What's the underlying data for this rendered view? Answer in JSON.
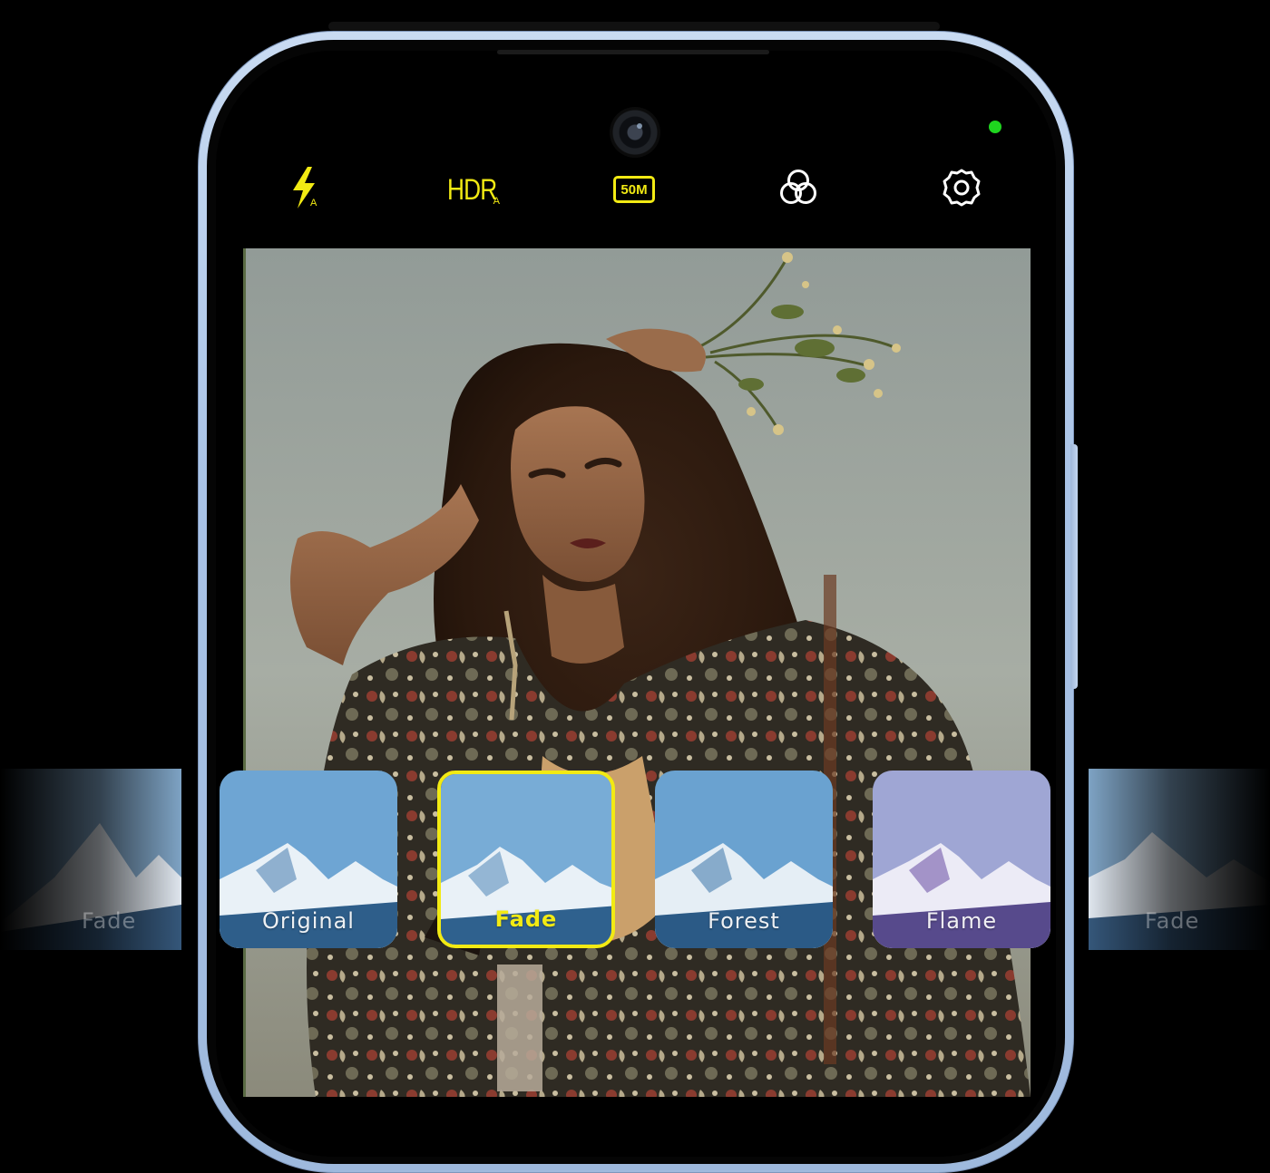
{
  "toolbar": {
    "flash": {
      "icon": "flash-auto-icon",
      "sub_label": "A"
    },
    "hdr": {
      "label": "HDR",
      "sub_label": "A"
    },
    "resolution": {
      "label": "50M"
    },
    "filters": {
      "icon": "filter-circles-icon"
    },
    "settings": {
      "icon": "gear-icon"
    }
  },
  "status": {
    "privacy_indicator": "camera-in-use-dot",
    "indicator_color": "#1fd51f"
  },
  "filters": {
    "items": [
      {
        "label": "Fade",
        "state": "partial-left"
      },
      {
        "label": "Original",
        "state": "normal"
      },
      {
        "label": "Fade",
        "state": "selected"
      },
      {
        "label": "Forest",
        "state": "normal"
      },
      {
        "label": "Flame",
        "state": "normal"
      },
      {
        "label": "Fade",
        "state": "partial-right"
      }
    ],
    "selected_index": 2
  },
  "colors": {
    "accent": "#f2ea13",
    "frame": "#b4cbea",
    "screen": "#000000"
  }
}
